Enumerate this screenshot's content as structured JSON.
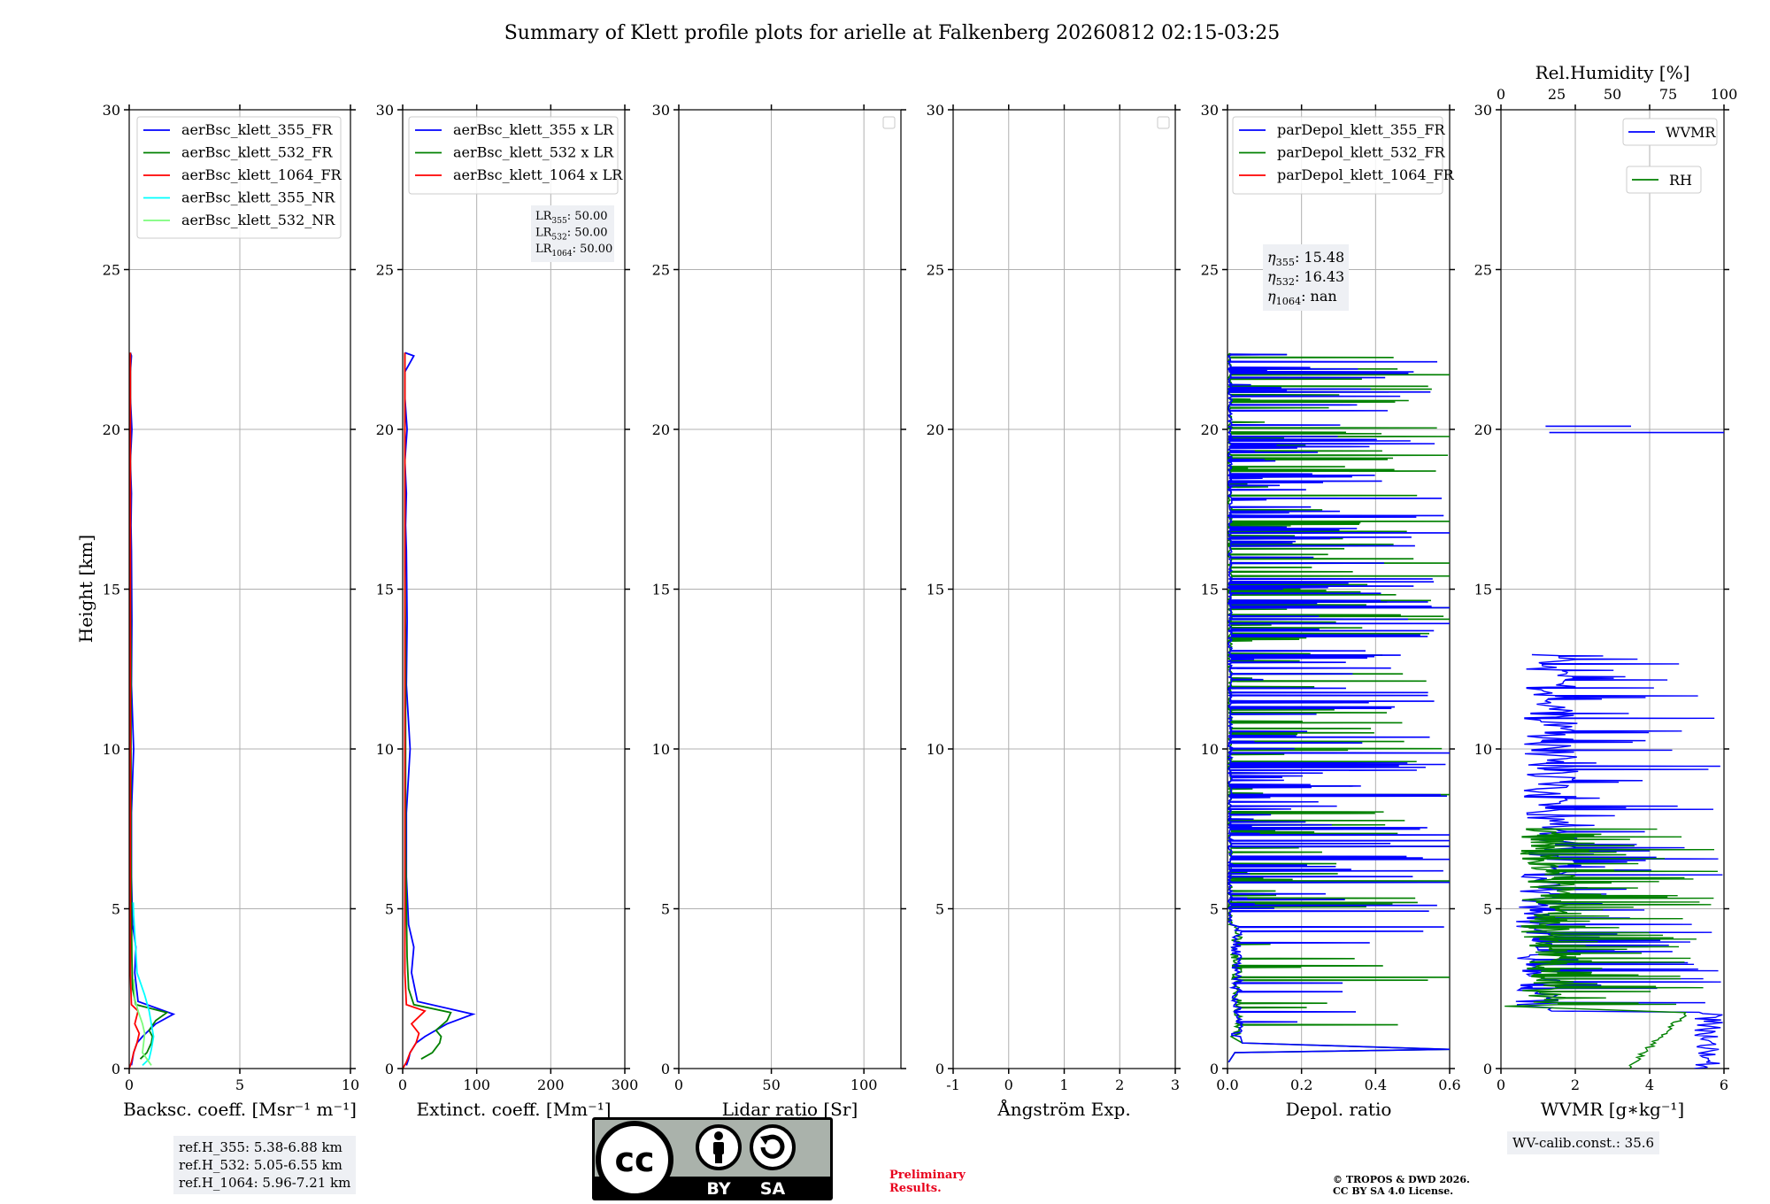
{
  "figure_title": "Summary of Klett profile plots for arielle at Falkenberg 20260812 02:15-03:25",
  "shared_ylabel": "Height [km]",
  "ref_heights": [
    "ref.H_355: 5.38-6.88 km",
    "ref.H_532: 5.05-6.55 km",
    "ref.H_1064: 5.96-7.21 km"
  ],
  "lidar_ratio_note": {
    "lines": [
      {
        "label": "LR",
        "sub": "355",
        "value": ": 50.00"
      },
      {
        "label": "LR",
        "sub": "532",
        "value": ": 50.00"
      },
      {
        "label": "LR",
        "sub": "1064",
        "value": ": 50.00"
      }
    ]
  },
  "eta_note": {
    "lines": [
      {
        "label": "η",
        "sub": "355",
        "value": ": 15.48"
      },
      {
        "label": "η",
        "sub": "532",
        "value": ": 16.43"
      },
      {
        "label": "η",
        "sub": "1064",
        "value": ": nan"
      }
    ]
  },
  "wv_calib": "WV-calib.const.: 35.6",
  "license_badge": {
    "cc": "cc",
    "by": "BY",
    "sa": "SA"
  },
  "preliminary": [
    "Preliminary",
    "Results."
  ],
  "copyright": [
    "© TROPOS & DWD 2026.",
    "CC BY SA 4.0 License."
  ],
  "colors": {
    "blue": "#0000ff",
    "green": "#008000",
    "red": "#ff0000",
    "cyan": "#00ffff",
    "lightgreen": "#7cfc7c",
    "grid": "#b0b0b0"
  },
  "chart_data": [
    {
      "type": "line",
      "xlabel": "Backsc. coeff. [Msr⁻¹ m⁻¹]",
      "xlim": [
        0,
        10
      ],
      "xticks": [
        0,
        5,
        10
      ],
      "ylim": [
        0,
        30
      ],
      "yticks": [
        0,
        5,
        10,
        15,
        20,
        25,
        30
      ],
      "legend": "top-left",
      "series": [
        {
          "name": "aerBsc_klett_355_FR",
          "color": "blue",
          "x": [
            0.1,
            0.15,
            0.2,
            0.35,
            0.6,
            1.2,
            2.0,
            0.4,
            0.25,
            0.3,
            0.15,
            0.1,
            0.1,
            0.2,
            0.1,
            0.12,
            0.1,
            0.08,
            0.1,
            0.05,
            0.12,
            0.05,
            0.05,
            0.1,
            0.05
          ],
          "y": [
            0.1,
            0.3,
            0.5,
            0.8,
            1.0,
            1.4,
            1.7,
            2.1,
            3.0,
            3.8,
            4.5,
            6,
            8,
            10,
            12,
            14,
            16.2,
            17,
            18,
            19,
            20,
            21,
            21.8,
            22.3,
            22.4
          ]
        },
        {
          "name": "aerBsc_klett_532_FR",
          "color": "green",
          "x": [
            0.5,
            0.8,
            1.0,
            1.05,
            0.9,
            1.2,
            1.7,
            0.3,
            0.15,
            0.12,
            0.1,
            0.08,
            0.08,
            0.08,
            0.05,
            0.05,
            0.05,
            0.05,
            0.05
          ],
          "y": [
            0.3,
            0.5,
            0.8,
            1.0,
            1.2,
            1.5,
            1.75,
            2.0,
            2.5,
            3.5,
            5,
            7,
            10,
            13,
            16,
            19,
            21,
            22.2,
            22.4
          ]
        },
        {
          "name": "aerBsc_klett_1064_FR",
          "color": "red",
          "x": [
            0.0,
            0.1,
            0.2,
            0.35,
            0.45,
            0.25,
            0.4,
            0.1,
            0.05,
            0.05,
            0.05,
            0.05,
            0.05,
            0.05,
            0.05
          ],
          "y": [
            0.0,
            0.2,
            0.5,
            0.8,
            1.1,
            1.4,
            1.8,
            2.0,
            3,
            5,
            8,
            12,
            16,
            20,
            22.4
          ]
        },
        {
          "name": "aerBsc_klett_355_NR",
          "color": "cyan",
          "x": [
            0.6,
            0.9,
            1.0,
            1.1,
            1.0,
            0.9,
            0.7,
            0.35,
            0.3,
            0.25,
            0.2,
            0.18
          ],
          "y": [
            0.1,
            0.3,
            0.6,
            1.0,
            1.4,
            1.8,
            2.3,
            3.0,
            3.7,
            4.2,
            4.8,
            5.2
          ]
        },
        {
          "name": "aerBsc_klett_532_NR",
          "color": "lightgreen",
          "x": [
            1.0,
            0.8,
            0.6,
            0.65,
            0.7,
            0.6,
            0.4,
            0.25,
            0.2
          ],
          "y": [
            0.1,
            0.3,
            0.5,
            0.8,
            1.1,
            1.4,
            1.8,
            2.2,
            2.8
          ]
        }
      ]
    },
    {
      "type": "line",
      "xlabel": "Extinct. coeff. [Mm⁻¹]",
      "xlim": [
        0,
        300
      ],
      "xticks": [
        0,
        100,
        200,
        300
      ],
      "ylim": [
        0,
        30
      ],
      "yticks": [
        0,
        5,
        10,
        15,
        20,
        25,
        30
      ],
      "legend": "top-left",
      "series": [
        {
          "name": "aerBsc_klett_355 x LR",
          "color": "blue",
          "x": [
            5,
            8,
            10,
            18,
            30,
            60,
            95,
            20,
            12,
            15,
            8,
            5,
            5,
            10,
            5,
            6,
            5,
            4,
            5,
            3,
            6,
            3,
            3,
            15,
            3
          ],
          "y": [
            0.1,
            0.3,
            0.5,
            0.8,
            1.0,
            1.4,
            1.7,
            2.1,
            3.0,
            3.8,
            4.5,
            6,
            8,
            10,
            12,
            14,
            16.2,
            17,
            18,
            19,
            20,
            21,
            21.8,
            22.3,
            22.4
          ]
        },
        {
          "name": "aerBsc_klett_532 x LR",
          "color": "green",
          "x": [
            25,
            40,
            50,
            52,
            45,
            60,
            65,
            15,
            8,
            6,
            5,
            4,
            4,
            4,
            3,
            3,
            3,
            3,
            3
          ],
          "y": [
            0.3,
            0.5,
            0.8,
            1.0,
            1.2,
            1.5,
            1.75,
            2.0,
            2.5,
            3.5,
            5,
            7,
            10,
            13,
            16,
            19,
            21,
            22.2,
            22.4
          ]
        },
        {
          "name": "aerBsc_klett_1064 x LR",
          "color": "red",
          "x": [
            0,
            5,
            10,
            18,
            22,
            12,
            30,
            5,
            3,
            3,
            3,
            3,
            3,
            3,
            3
          ],
          "y": [
            0.0,
            0.2,
            0.5,
            0.8,
            1.1,
            1.4,
            1.8,
            2.0,
            3,
            5,
            8,
            12,
            16,
            20,
            22.4
          ]
        }
      ]
    },
    {
      "type": "line",
      "xlabel": "Lidar ratio [Sr]",
      "xlim": [
        0,
        120
      ],
      "xticks": [
        0,
        50,
        100
      ],
      "ylim": [
        0,
        30
      ],
      "yticks": [
        0,
        5,
        10,
        15,
        20,
        25,
        30
      ],
      "legend": "top-right",
      "series": []
    },
    {
      "type": "line",
      "xlabel": "Ångström Exp.",
      "xlim": [
        -1,
        3
      ],
      "xticks": [
        -1,
        0,
        1,
        2,
        3
      ],
      "ylim": [
        0,
        30
      ],
      "yticks": [
        0,
        5,
        10,
        15,
        20,
        25,
        30
      ],
      "legend": "top-right",
      "series": []
    },
    {
      "type": "line",
      "xlabel": "Depol. ratio",
      "xlim": [
        0,
        0.6
      ],
      "xticks": [
        0.0,
        0.2,
        0.4,
        0.6
      ],
      "xtick_labels": [
        "0.0",
        "0.2",
        "0.4",
        "0.6"
      ],
      "ylim": [
        0,
        30
      ],
      "yticks": [
        0,
        5,
        10,
        15,
        20,
        25,
        30
      ],
      "legend": "top-left",
      "series": [
        {
          "name": "parDepol_klett_355_FR",
          "color": "blue",
          "x": [],
          "y": []
        },
        {
          "name": "parDepol_klett_532_FR",
          "color": "green",
          "x": [],
          "y": []
        },
        {
          "name": "parDepol_klett_1064_FR",
          "color": "red",
          "x": [],
          "y": []
        }
      ]
    },
    {
      "type": "line",
      "xlabel": "WVMR [g∗kg⁻¹]",
      "xlim": [
        0,
        6
      ],
      "xticks": [
        0,
        2,
        4,
        6
      ],
      "top_axis": {
        "label": "Rel.Humidity [%]",
        "lim": [
          0,
          100
        ],
        "ticks": [
          0,
          25,
          50,
          75,
          100
        ]
      },
      "ylim": [
        0,
        30
      ],
      "yticks": [
        0,
        5,
        10,
        15,
        20,
        25,
        30
      ],
      "legend": "top-right",
      "series": [
        {
          "name": "WVMR",
          "color": "blue",
          "x": [],
          "y": []
        },
        {
          "name": "RH",
          "color": "green",
          "x": [],
          "y": []
        }
      ]
    }
  ]
}
